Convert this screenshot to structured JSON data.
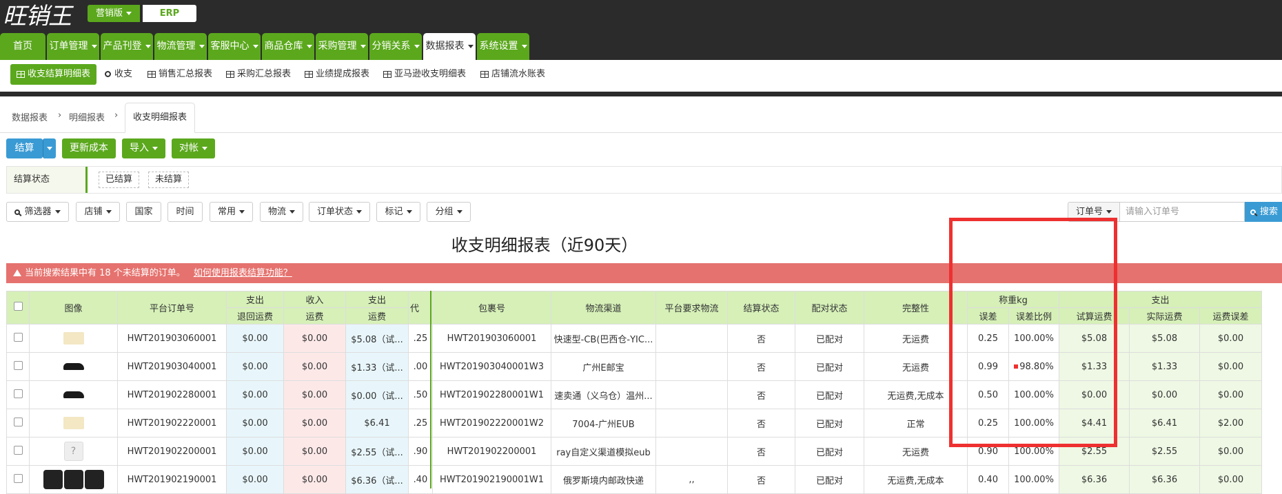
{
  "brand": {
    "logo_text": "旺销王",
    "version_label": "营销版",
    "erp_label": "ERP"
  },
  "nav": {
    "tabs": [
      "首页",
      "订单管理",
      "产品刊登",
      "物流管理",
      "客服中心",
      "商品仓库",
      "采购管理",
      "分销关系",
      "数据报表",
      "系统设置"
    ]
  },
  "subnav": {
    "items": [
      "收支结算明细表",
      "收支",
      "销售汇总报表",
      "采购汇总报表",
      "业绩提成报表",
      "亚马逊收支明细表",
      "店铺流水账表"
    ]
  },
  "breadcrumb": {
    "items": [
      "数据报表",
      "明细报表",
      "收支明细报表"
    ]
  },
  "toolbar": {
    "settle": "结算",
    "update_cost": "更新成本",
    "import": "导入",
    "reconcile": "对帐"
  },
  "settle_status": {
    "label": "结算状态",
    "options": [
      "已结算",
      "未结算"
    ]
  },
  "filters": {
    "items": [
      "筛选器",
      "店铺",
      "国家",
      "时间",
      "常用",
      "物流",
      "订单状态",
      "标记",
      "分组"
    ]
  },
  "search": {
    "field_select": "订单号",
    "placeholder": "请输入订单号",
    "button": "搜索"
  },
  "report": {
    "title": "收支明细报表（近90天）"
  },
  "alert": {
    "message": "当前搜索结果中有 18 个未结算的订单。",
    "link": "如何使用报表结算功能？"
  },
  "table": {
    "group_headers": {
      "out1": "支出",
      "income": "收入",
      "out2": "支出",
      "weight": "称重kg",
      "out3": "支出"
    },
    "headers": {
      "image": "图像",
      "order_no": "平台订单号",
      "return_ship": "退回运费",
      "income_ship": "运费",
      "out_ship": "运费",
      "cut_col": "代",
      "package_no": "包裹号",
      "channel": "物流渠道",
      "platform_req": "平台要求物流",
      "settle_state": "结算状态",
      "match_state": "配对状态",
      "complete": "完整性",
      "err": "误差",
      "err_ratio": "误差比例",
      "trial_ship": "试算运费",
      "actual_ship": "实际运费",
      "ship_err": "运费误差"
    },
    "rows": [
      {
        "order_no": "HWT201903060001",
        "return_ship": "$0.00",
        "income_ship": "$0.00",
        "out_ship": "$5.08（试...",
        "cut": ".25",
        "package_no": "HWT201903060001",
        "channel": "快速型-CB(巴西仓-YIC...",
        "platform_req": "",
        "settle": "否",
        "match": "已配对",
        "complete": "无运费",
        "err": "0.25",
        "ratio": "100.00%",
        "trial": "$5.08",
        "actual": "$5.08",
        "ship_err": "$0.00"
      },
      {
        "order_no": "HWT201903040001",
        "return_ship": "$0.00",
        "income_ship": "$0.00",
        "out_ship": "$1.33（试...",
        "cut": ".00",
        "package_no": "HWT201903040001W3",
        "channel": "广州E邮宝",
        "platform_req": "",
        "settle": "否",
        "match": "已配对",
        "complete": "无运费",
        "err": "0.99",
        "ratio": "98.80%",
        "trial": "$1.33",
        "actual": "$1.33",
        "ship_err": "$0.00"
      },
      {
        "order_no": "HWT201902280001",
        "return_ship": "$0.00",
        "income_ship": "$0.00",
        "out_ship": "$0.00（试...",
        "cut": ".50",
        "package_no": "HWT201902280001W1",
        "channel": "速卖通（义乌仓）温州...",
        "platform_req": "",
        "settle": "否",
        "match": "已配对",
        "complete": "无运费,无成本",
        "err": "0.50",
        "ratio": "100.00%",
        "trial": "$0.00",
        "actual": "$0.00",
        "ship_err": "$0.00"
      },
      {
        "order_no": "HWT201902220001",
        "return_ship": "$0.00",
        "income_ship": "$0.00",
        "out_ship": "$6.41",
        "cut": ".25",
        "package_no": "HWT201902220001W2",
        "channel": "7004-广州EUB",
        "platform_req": "",
        "settle": "否",
        "match": "已配对",
        "complete": "正常",
        "err": "0.25",
        "ratio": "100.00%",
        "trial": "$4.41",
        "actual": "$6.41",
        "ship_err": "$2.00"
      },
      {
        "order_no": "HWT201902200001",
        "return_ship": "$0.00",
        "income_ship": "$0.00",
        "out_ship": "$2.55（试...",
        "cut": ".90",
        "package_no": "HWT201902200001",
        "channel": "ray自定义渠道模拟eub",
        "platform_req": "",
        "settle": "否",
        "match": "已配对",
        "complete": "无运费",
        "err": "0.90",
        "ratio": "100.00%",
        "trial": "$2.55",
        "actual": "$2.55",
        "ship_err": "$0.00"
      },
      {
        "order_no": "HWT201902190001",
        "return_ship": "$0.00",
        "income_ship": "$0.00",
        "out_ship": "$6.36（试...",
        "cut": ".40",
        "package_no": "HWT201902190001W1",
        "channel": "俄罗斯境内邮政快递",
        "platform_req": ",,",
        "settle": "否",
        "match": "已配对",
        "complete": "无运费,无成本",
        "err": "0.40",
        "ratio": "100.00%",
        "trial": "$6.36",
        "actual": "$6.36",
        "ship_err": "$0.00"
      }
    ]
  },
  "colors": {
    "brand_green": "#5ba81d",
    "header_green": "#d6f0b8",
    "alert_red": "#e5726e",
    "annotation_red": "#ee3030",
    "link_blue": "#3a9bd4"
  }
}
